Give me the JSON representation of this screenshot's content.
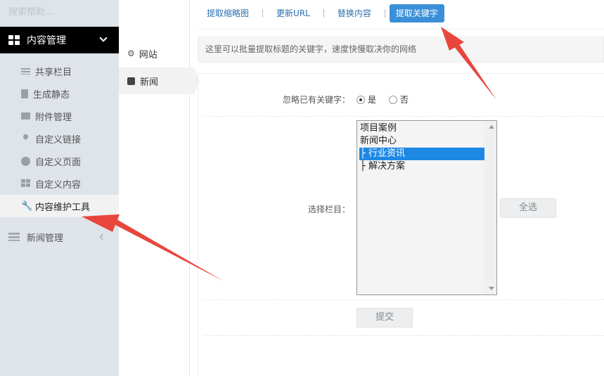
{
  "sidebar": {
    "search_placeholder": "搜索帮助...",
    "group_title": "内容管理",
    "items": [
      {
        "label": "共享栏目",
        "icon": "list-icon"
      },
      {
        "label": "生成静态",
        "icon": "file-icon"
      },
      {
        "label": "附件管理",
        "icon": "folder-icon"
      },
      {
        "label": "自定义链接",
        "icon": "pin-icon"
      },
      {
        "label": "自定义页面",
        "icon": "circle-icon"
      },
      {
        "label": "自定义内容",
        "icon": "grid-icon"
      },
      {
        "label": "内容维护工具",
        "icon": "wrench-icon",
        "active": true
      }
    ],
    "group2_title": "新闻管理"
  },
  "col2": {
    "items": [
      {
        "label": "网站",
        "icon": "gear-icon"
      },
      {
        "label": "新闻",
        "icon": "square-icon",
        "active": true
      }
    ]
  },
  "tabs": [
    "提取缩略图",
    "更新URL",
    "替换内容",
    "提取关键字"
  ],
  "active_tab": "提取关键字",
  "info_text": "这里可以批量提取标题的关键字，速度快慢取决你的网络",
  "form": {
    "ignore_label": "忽略已有关键字：",
    "yes": "是",
    "no": "否",
    "selected_radio": "是",
    "column_label": "选择栏目：",
    "options": [
      "项目案例",
      "新闻中心",
      "├ 行业资讯",
      "├ 解决方案"
    ],
    "selected_option": "├ 行业资讯",
    "select_all": "全选",
    "submit": "提交"
  },
  "colors": {
    "accent": "#3b8fd8",
    "annotation_arrow": "#e8463c",
    "sidebar_bg": "#dfe3ea",
    "menu_head_bg": "#000000"
  }
}
